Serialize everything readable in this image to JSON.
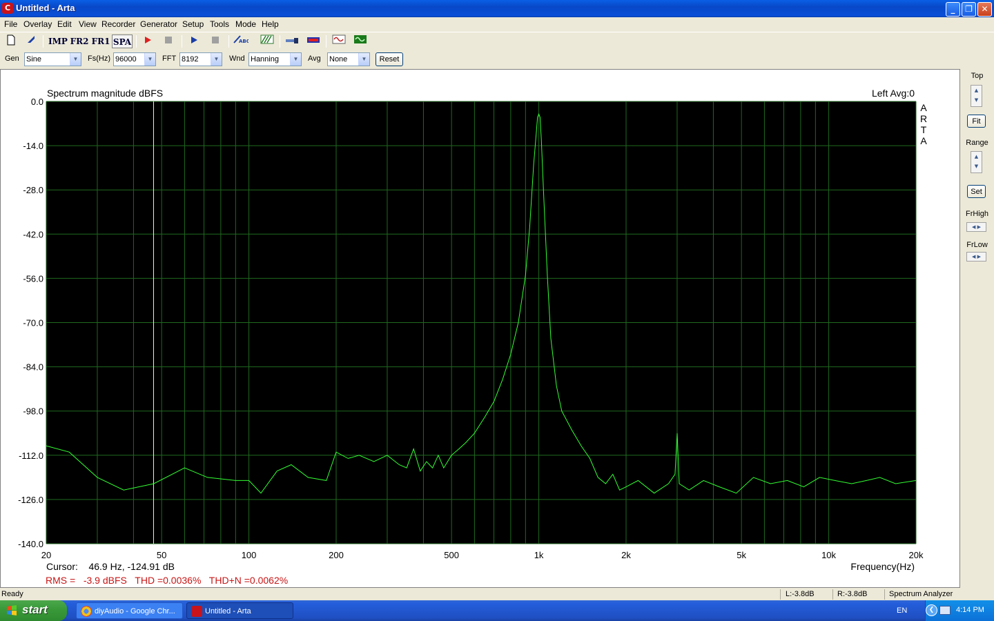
{
  "window": {
    "title": "Untitled - Arta",
    "minimize": "_",
    "maximize": "❐",
    "close": "✕"
  },
  "menu": [
    "File",
    "Overlay",
    "Edit",
    "View",
    "Recorder",
    "Generator",
    "Setup",
    "Tools",
    "Mode",
    "Help"
  ],
  "toolbar": {
    "imp": "IMP",
    "fr2": "FR2",
    "fr1": "FR1",
    "spa": "SPA"
  },
  "settings": {
    "gen_label": "Gen",
    "gen_value": "Sine",
    "fs_label": "Fs(Hz)",
    "fs_value": "96000",
    "fft_label": "FFT",
    "fft_value": "8192",
    "wnd_label": "Wnd",
    "wnd_value": "Hanning",
    "avg_label": "Avg",
    "avg_value": "None",
    "reset_label": "Reset"
  },
  "right_panel": {
    "top": "Top",
    "fit": "Fit",
    "range": "Range",
    "set": "Set",
    "frhigh": "FrHigh",
    "frlow": "FrLow"
  },
  "chart_data": {
    "type": "line",
    "title": "Spectrum magnitude dBFS",
    "channel_info": "Left  Avg:0",
    "watermark": [
      "A",
      "R",
      "T",
      "A"
    ],
    "xlabel": "Frequency(Hz)",
    "x_scale": "log",
    "xlim": [
      20,
      20000
    ],
    "ylim": [
      -140,
      0
    ],
    "x_ticks": [
      20,
      50,
      100,
      200,
      500,
      1000,
      2000,
      5000,
      10000,
      20000
    ],
    "x_tick_labels": [
      "20",
      "50",
      "100",
      "200",
      "500",
      "1k",
      "2k",
      "5k",
      "10k",
      "20k"
    ],
    "y_ticks": [
      0,
      -14,
      -28,
      -42,
      -56,
      -70,
      -84,
      -98,
      -112,
      -126,
      -140
    ],
    "y_tick_labels": [
      "0.0",
      "-14.0",
      "-28.0",
      "-42.0",
      "-56.0",
      "-70.0",
      "-84.0",
      "-98.0",
      "-112.0",
      "-126.0",
      "-140.0"
    ],
    "grid": true,
    "background": "#000000",
    "grid_color": "#1f6a1f",
    "series_color": "#33ff33",
    "cursor_x": 46.9,
    "cursor_color": "#ffff99",
    "series": [
      {
        "x": [
          20,
          24,
          30,
          37,
          47,
          60,
          72,
          90,
          100,
          110,
          125,
          140,
          160,
          185,
          200,
          220,
          240,
          270,
          300,
          330,
          350,
          370,
          390,
          410,
          430,
          450,
          470,
          500,
          530,
          560,
          600,
          650,
          700,
          750,
          800,
          850,
          900,
          930,
          960,
          980,
          990,
          1000,
          1010,
          1020,
          1040,
          1070,
          1100,
          1150,
          1200,
          1300,
          1400,
          1500,
          1600,
          1700,
          1800,
          1900,
          2000,
          2200,
          2500,
          2800,
          2950,
          3000,
          3050,
          3300,
          3700,
          4200,
          4800,
          5500,
          6300,
          7200,
          8200,
          9300,
          10500,
          12000,
          13500,
          15000,
          17000,
          20000
        ],
        "y": [
          -109,
          -111,
          -119,
          -123,
          -121,
          -116,
          -119,
          -120,
          -120,
          -124,
          -117,
          -115,
          -119,
          -120,
          -111,
          -113,
          -112,
          -114,
          -112,
          -115,
          -116,
          -110,
          -117,
          -114,
          -116,
          -112,
          -116,
          -112,
          -110,
          -108,
          -105,
          -100,
          -95,
          -88,
          -80,
          -70,
          -55,
          -40,
          -20,
          -10,
          -5,
          -4,
          -5,
          -12,
          -30,
          -55,
          -75,
          -90,
          -98,
          -104,
          -109,
          -113,
          -119,
          -121,
          -118,
          -123,
          -122,
          -120,
          -124,
          -121,
          -118,
          -105,
          -121,
          -123,
          -120,
          -122,
          -124,
          -119,
          -121,
          -120,
          -122,
          -119,
          -120,
          -121,
          -120,
          -119,
          -121,
          -120
        ]
      }
    ],
    "cursor_readout": "Cursor:    46.9 Hz, -124.91 dB",
    "measurements": "RMS =   -3.9 dBFS   THD =0.0036%   THD+N =0.0062%"
  },
  "status": {
    "ready": "Ready",
    "left": "L:-3.8dB",
    "right": "R:-3.8dB",
    "mode": "Spectrum Analyzer"
  },
  "taskbar": {
    "start": "start",
    "tasks": [
      "diyAudio - Google Chr...",
      "Untitled - Arta"
    ],
    "lang": "EN",
    "clock": "4:14 PM"
  }
}
